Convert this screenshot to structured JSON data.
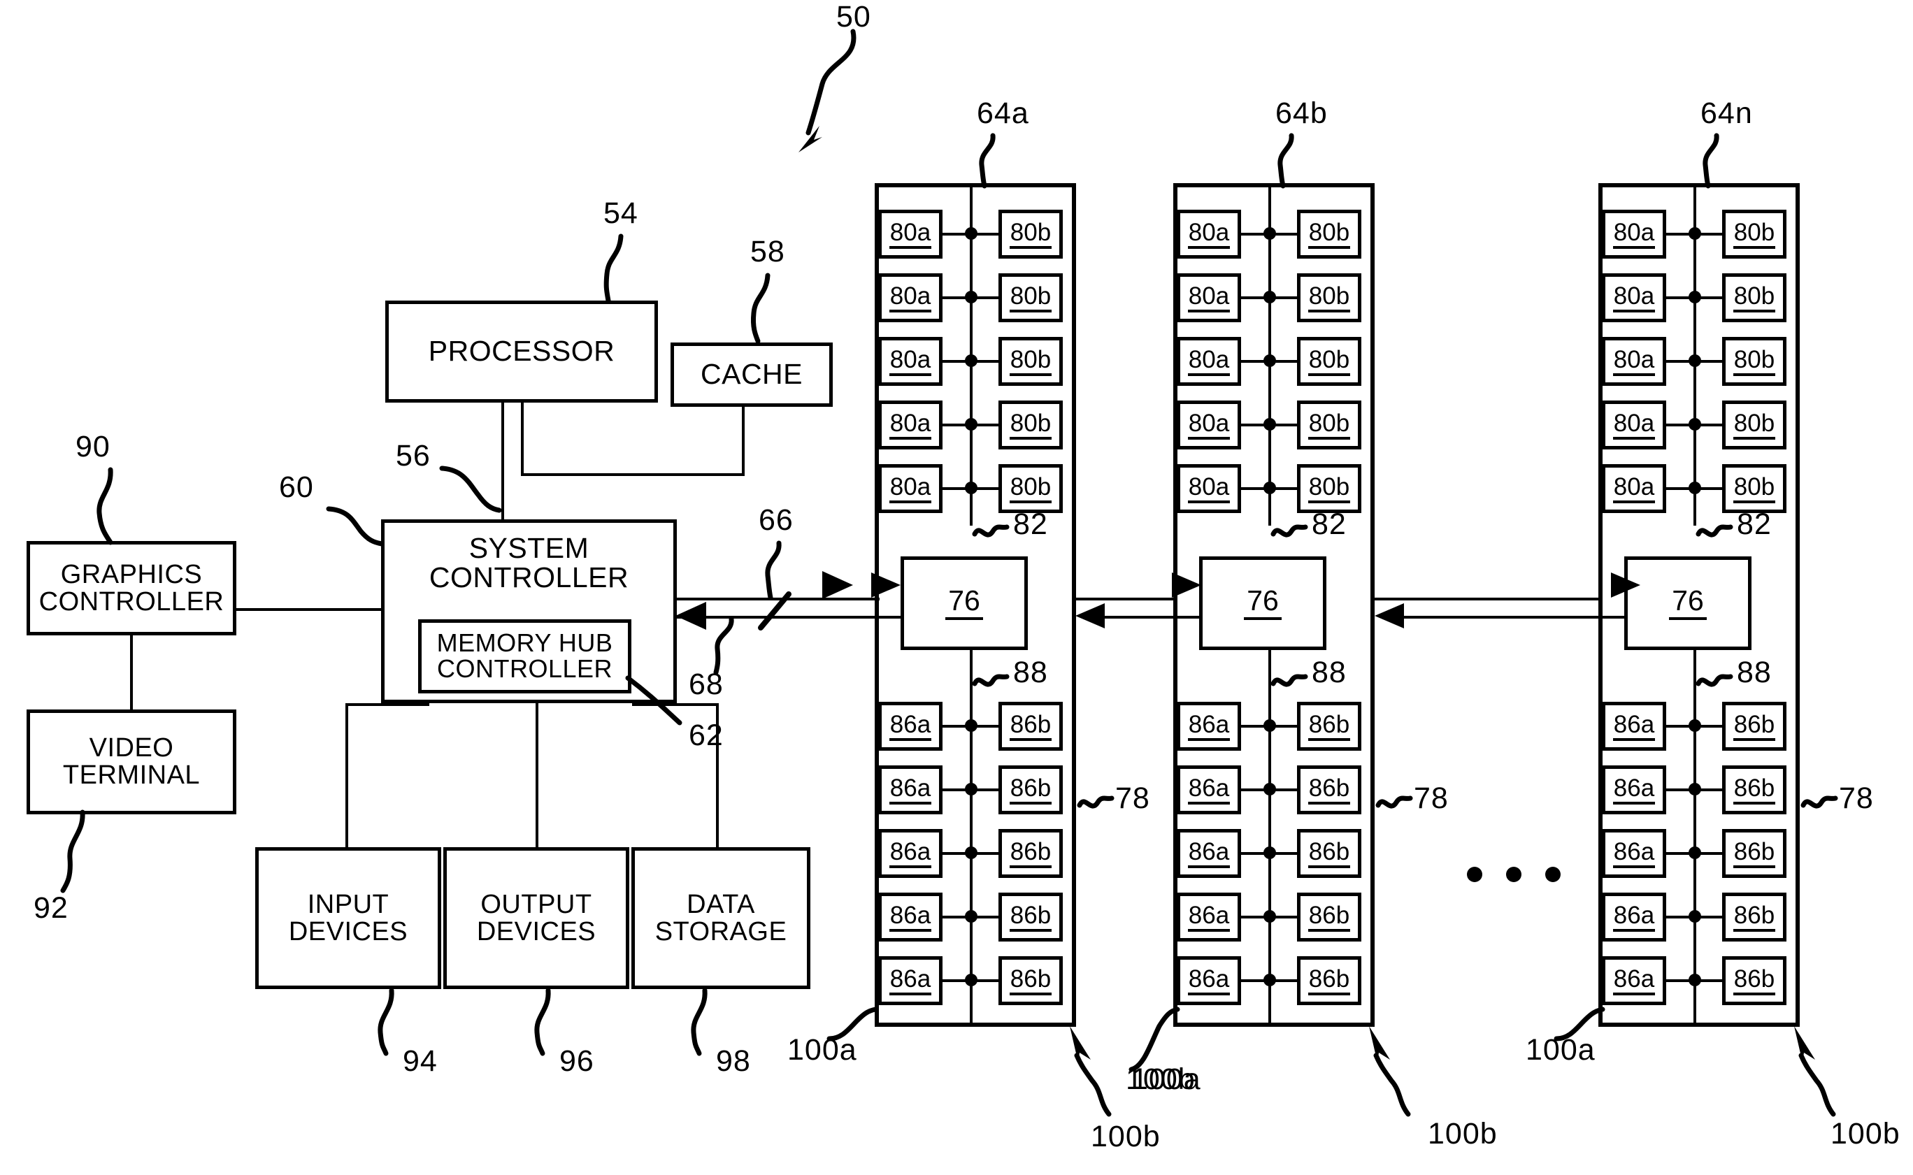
{
  "figure": {
    "type": "patent-block-diagram",
    "overall_ref": "50",
    "background": "#ffffff",
    "ink": "#000000"
  },
  "blocks": {
    "processor": {
      "label": "PROCESSOR",
      "ref": "54"
    },
    "cache": {
      "label": "CACHE",
      "ref": "58"
    },
    "system_controller": {
      "label": "SYSTEM\nCONTROLLER",
      "ref": "60"
    },
    "memory_hub_controller": {
      "label": "MEMORY HUB\nCONTROLLER",
      "ref": "62"
    },
    "graphics_controller": {
      "label": "GRAPHICS\nCONTROLLER",
      "ref": "90"
    },
    "video_terminal": {
      "label": "VIDEO\nTERMINAL",
      "ref": "92"
    },
    "input_devices": {
      "label": "INPUT\nDEVICES",
      "ref": "94"
    },
    "output_devices": {
      "label": "OUTPUT\nDEVICES",
      "ref": "96"
    },
    "data_storage": {
      "label": "DATA\nSTORAGE",
      "ref": "98"
    }
  },
  "buses": {
    "processor_bus_ref": "56",
    "downstream_bus_ref": "66",
    "upstream_bus_ref": "68"
  },
  "memory_modules": [
    {
      "ref": "64a",
      "hub": "76",
      "upper_bus_ref": "82",
      "lower_bus_ref": "88",
      "module_ref": "78",
      "left_edge_ref": "100a",
      "right_edge_ref": "100b",
      "upper_devices_a": [
        "80a",
        "80a",
        "80a",
        "80a",
        "80a"
      ],
      "upper_devices_b": [
        "80b",
        "80b",
        "80b",
        "80b",
        "80b"
      ],
      "lower_devices_a": [
        "86a",
        "86a",
        "86a",
        "86a",
        "86a"
      ],
      "lower_devices_b": [
        "86b",
        "86b",
        "86b",
        "86b",
        "86b"
      ]
    },
    {
      "ref": "64b",
      "hub": "76",
      "upper_bus_ref": "82",
      "lower_bus_ref": "88",
      "module_ref": "78",
      "left_edge_ref": "100a",
      "right_edge_ref": "100b",
      "upper_devices_a": [
        "80a",
        "80a",
        "80a",
        "80a",
        "80a"
      ],
      "upper_devices_b": [
        "80b",
        "80b",
        "80b",
        "80b",
        "80b"
      ],
      "lower_devices_a": [
        "86a",
        "86a",
        "86a",
        "86a",
        "86a"
      ],
      "lower_devices_b": [
        "86b",
        "86b",
        "86b",
        "86b",
        "86b"
      ]
    },
    {
      "ref": "64n",
      "hub": "76",
      "upper_bus_ref": "82",
      "lower_bus_ref": "88",
      "module_ref": "78",
      "left_edge_ref": "100a",
      "right_edge_ref": "100b",
      "upper_devices_a": [
        "80a",
        "80a",
        "80a",
        "80a",
        "80a"
      ],
      "upper_devices_b": [
        "80b",
        "80b",
        "80b",
        "80b",
        "80b"
      ],
      "lower_devices_a": [
        "86a",
        "86a",
        "86a",
        "86a",
        "86a"
      ],
      "lower_devices_b": [
        "86b",
        "86b",
        "86b",
        "86b",
        "86b"
      ]
    }
  ],
  "continuation": {
    "symbol": "•  •  •"
  }
}
